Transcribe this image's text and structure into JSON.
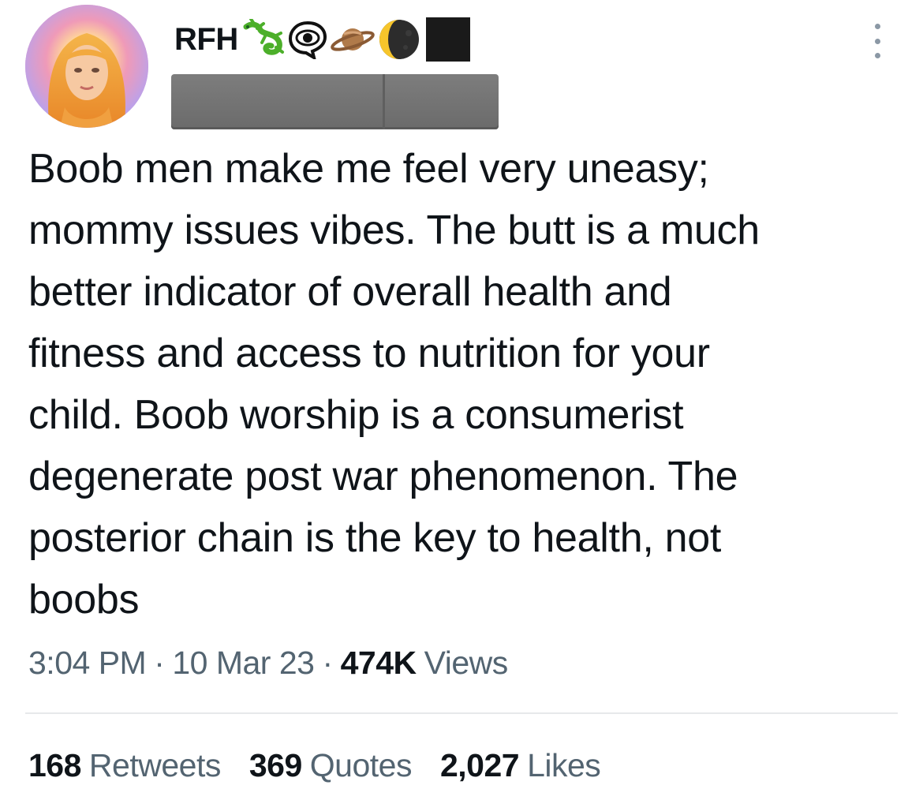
{
  "author": {
    "display_name": "RFH",
    "name_emojis": [
      "lizard-icon",
      "eye-in-speech-bubble-icon",
      "ringed-planet-icon",
      "last-quarter-moon-icon",
      "black-square-icon"
    ],
    "handle": ""
  },
  "tweet": {
    "lines": [
      "Boob men make me feel very uneasy;",
      "mommy issues vibes. The butt is a much",
      "better indicator of overall health and",
      "fitness and access to nutrition for your",
      "child. Boob worship is a consumerist",
      "degenerate post war phenomenon. The",
      "posterior chain is the key to health, not",
      "boobs"
    ],
    "time": "3:04 PM",
    "date": "10 Mar 23",
    "separator": "·",
    "views_count": "474K",
    "views_label": "Views"
  },
  "stats": [
    {
      "count": "168",
      "label": "Retweets"
    },
    {
      "count": "369",
      "label": "Quotes"
    },
    {
      "count": "2,027",
      "label": "Likes"
    }
  ],
  "colors": {
    "text": "#0f1419",
    "secondary": "#536471",
    "divider": "#e7e9ea",
    "redaction": "#6e6e6e"
  }
}
